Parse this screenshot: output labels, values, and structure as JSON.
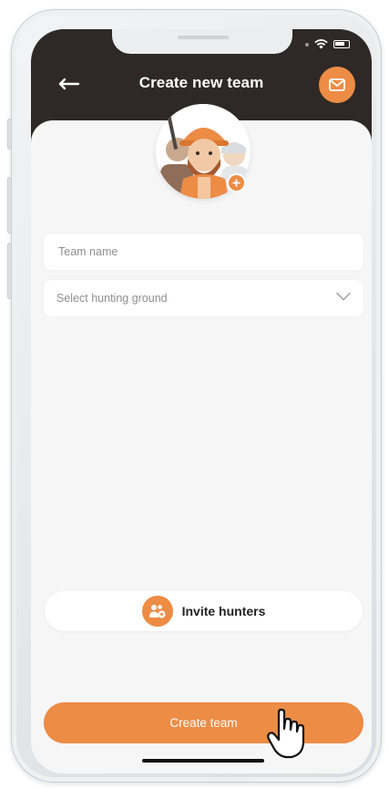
{
  "header": {
    "title": "Create new team",
    "back_icon": "arrow-left-icon",
    "mail_icon": "envelope-icon"
  },
  "status_bar": {
    "icons": [
      "signal-icon",
      "wifi-icon",
      "battery-icon"
    ]
  },
  "avatar": {
    "add_icon": "plus-icon"
  },
  "form": {
    "team_name_placeholder": "Team name",
    "hunting_ground_placeholder": "Select hunting ground",
    "dropdown_icon": "chevron-down-icon"
  },
  "invite": {
    "label": "Invite hunters",
    "icon": "users-add-icon"
  },
  "create_button": {
    "label": "Create team"
  },
  "colors": {
    "accent": "#ec8c45",
    "header_bg": "#2e2926",
    "screen_bg": "#f6f6f7",
    "text_dark": "#222222",
    "placeholder": "#8f8f8f"
  }
}
